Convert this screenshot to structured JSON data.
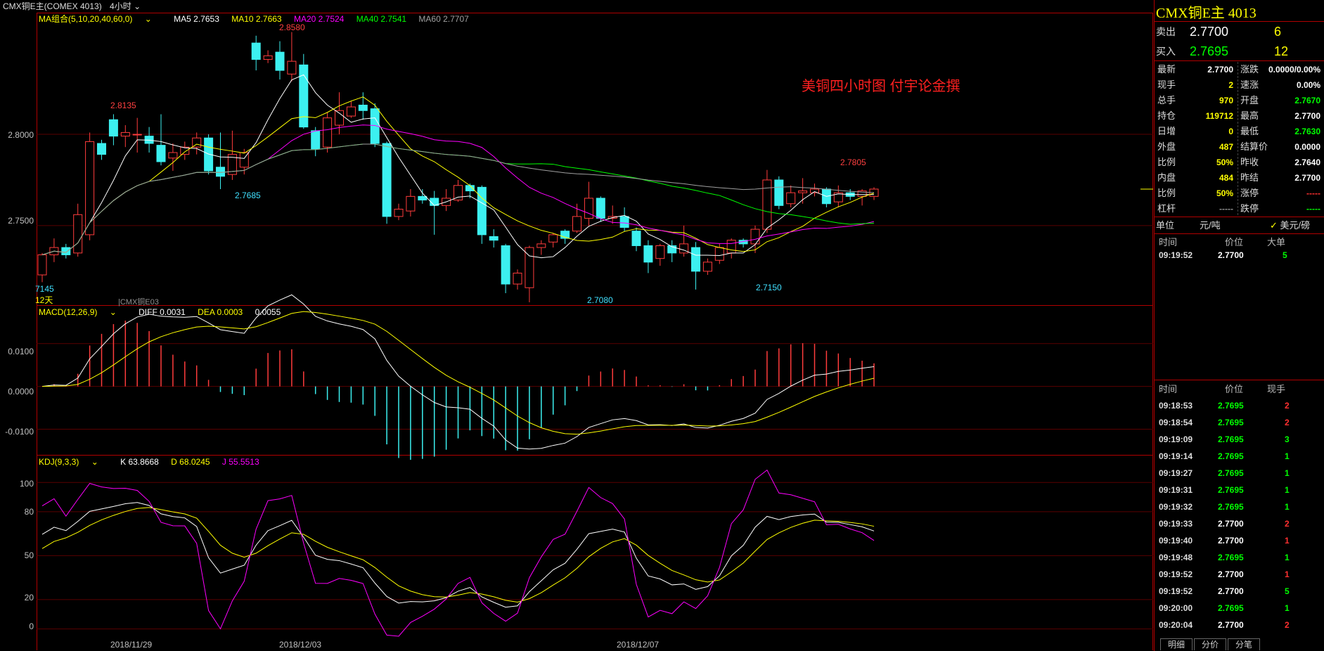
{
  "titlebar": {
    "symbol": "CMX铜E主(COMEX 4013)",
    "period": "4小时"
  },
  "annotation_text": "美铜四小时图  付宇论金撰",
  "ma_legend": {
    "group": "MA组合(5,10,20,40,60,0)",
    "ma5": "MA5 2.7653",
    "ma10": "MA10 2.7663",
    "ma20": "MA20 2.7524",
    "ma40": "MA40 2.7541",
    "ma60": "MA60 2.7707",
    "colors": {
      "ma5": "#ffffff",
      "ma10": "#ffff00",
      "ma20": "#ff00ff",
      "ma40": "#00ff00",
      "ma60": "#a0a0a0"
    }
  },
  "macd_legend": {
    "title": "MACD(12,26,9)",
    "diff": "DIFF 0.0031",
    "dea": "DEA 0.0003",
    "macd": "0.0055"
  },
  "kdj_legend": {
    "title": "KDJ(9,3,3)",
    "k": "K 63.8668",
    "d": "D 68.0245",
    "j": "J 55.5513"
  },
  "price_axis": [
    "2.8000",
    "2.7500"
  ],
  "macd_axis": [
    "0.0100",
    "0.0000",
    "-0.0100"
  ],
  "kdj_axis": [
    "100",
    "80",
    "50",
    "20",
    "0"
  ],
  "date_axis": [
    "2018/11/29",
    "2018/12/03",
    "2018/12/07"
  ],
  "price_annotations": [
    {
      "text": "2.8580",
      "color": "#ff4040"
    },
    {
      "text": "2.8135",
      "color": "#ff4040"
    },
    {
      "text": "2.7685",
      "color": "#40e0ff"
    },
    {
      "text": "2.7805",
      "color": "#ff4040"
    },
    {
      "text": "2.7080",
      "color": "#40e0ff"
    },
    {
      "text": "2.7150",
      "color": "#40e0ff"
    },
    {
      "text": "7145",
      "color": "#40e0ff"
    },
    {
      "text": "12天",
      "color": "#ffff00"
    },
    {
      "text": "|CMX铜E03",
      "color": "#909090"
    }
  ],
  "chart_data": {
    "type": "candlestick",
    "candles": [
      [
        2.723,
        2.734,
        2.719,
        2.735
      ],
      [
        2.734,
        2.738,
        2.73,
        2.743
      ],
      [
        2.738,
        2.734,
        2.732,
        2.74
      ],
      [
        2.735,
        2.756,
        2.733,
        2.762
      ],
      [
        2.745,
        2.796,
        2.742,
        2.801
      ],
      [
        2.795,
        2.789,
        2.786,
        2.797
      ],
      [
        2.808,
        2.799,
        2.794,
        2.811
      ],
      [
        2.799,
        2.801,
        2.793,
        2.805
      ],
      [
        2.8,
        2.8,
        2.79,
        2.809
      ],
      [
        2.799,
        2.795,
        2.79,
        2.804
      ],
      [
        2.794,
        2.785,
        2.783,
        2.811
      ],
      [
        2.787,
        2.79,
        2.78,
        2.795
      ],
      [
        2.789,
        2.793,
        2.786,
        2.796
      ],
      [
        2.793,
        2.798,
        2.789,
        2.801
      ],
      [
        2.798,
        2.78,
        2.778,
        2.8
      ],
      [
        2.782,
        2.777,
        2.77,
        2.801
      ],
      [
        2.778,
        2.789,
        2.775,
        2.802
      ],
      [
        2.782,
        2.79,
        2.778,
        2.792
      ],
      [
        2.85,
        2.841,
        2.835,
        2.854
      ],
      [
        2.841,
        2.843,
        2.839,
        2.846
      ],
      [
        2.845,
        2.835,
        2.83,
        2.851
      ],
      [
        2.833,
        2.84,
        2.829,
        2.856
      ],
      [
        2.838,
        2.804,
        2.803,
        2.844
      ],
      [
        2.802,
        2.792,
        2.788,
        2.804
      ],
      [
        2.793,
        2.809,
        2.79,
        2.812
      ],
      [
        2.805,
        2.813,
        2.8,
        2.823
      ],
      [
        2.81,
        2.815,
        2.809,
        2.818
      ],
      [
        2.816,
        2.813,
        2.808,
        2.823
      ],
      [
        2.814,
        2.795,
        2.793,
        2.817
      ],
      [
        2.795,
        2.755,
        2.751,
        2.796
      ],
      [
        2.755,
        2.759,
        2.753,
        2.762
      ],
      [
        2.758,
        2.766,
        2.755,
        2.77
      ],
      [
        2.766,
        2.764,
        2.762,
        2.77
      ],
      [
        2.765,
        2.761,
        2.745,
        2.769
      ],
      [
        2.761,
        2.765,
        2.758,
        2.77
      ],
      [
        2.764,
        2.772,
        2.763,
        2.775
      ],
      [
        2.772,
        2.769,
        2.765,
        2.773
      ],
      [
        2.771,
        2.745,
        2.74,
        2.772
      ],
      [
        2.744,
        2.742,
        2.738,
        2.748
      ],
      [
        2.739,
        2.718,
        2.713,
        2.74
      ],
      [
        2.718,
        2.724,
        2.715,
        2.726
      ],
      [
        2.716,
        2.738,
        2.708,
        2.739
      ],
      [
        2.738,
        2.74,
        2.734,
        2.742
      ],
      [
        2.741,
        2.745,
        2.738,
        2.746
      ],
      [
        2.747,
        2.743,
        2.74,
        2.748
      ],
      [
        2.747,
        2.755,
        2.746,
        2.762
      ],
      [
        2.754,
        2.765,
        2.75,
        2.774
      ],
      [
        2.765,
        2.754,
        2.752,
        2.766
      ],
      [
        2.754,
        2.755,
        2.751,
        2.761
      ],
      [
        2.755,
        2.749,
        2.747,
        2.76
      ],
      [
        2.747,
        2.739,
        2.736,
        2.749
      ],
      [
        2.739,
        2.73,
        2.724,
        2.742
      ],
      [
        2.732,
        2.739,
        2.728,
        2.74
      ],
      [
        2.739,
        2.735,
        2.73,
        2.742
      ],
      [
        2.735,
        2.74,
        2.733,
        2.75
      ],
      [
        2.738,
        2.725,
        2.715,
        2.741
      ],
      [
        2.725,
        2.73,
        2.723,
        2.732
      ],
      [
        2.731,
        2.738,
        2.729,
        2.74
      ],
      [
        2.735,
        2.742,
        2.732,
        2.743
      ],
      [
        2.742,
        2.74,
        2.738,
        2.743
      ],
      [
        2.74,
        2.748,
        2.735,
        2.75
      ],
      [
        2.748,
        2.775,
        2.746,
        2.7805
      ],
      [
        2.775,
        2.761,
        2.759,
        2.777
      ],
      [
        2.762,
        2.768,
        2.76,
        2.772
      ],
      [
        2.768,
        2.769,
        2.762,
        2.776
      ],
      [
        2.768,
        2.77,
        2.766,
        2.773
      ],
      [
        2.77,
        2.762,
        2.76,
        2.771
      ],
      [
        2.763,
        2.768,
        2.76,
        2.772
      ],
      [
        2.768,
        2.766,
        2.764,
        2.77
      ],
      [
        2.766,
        2.769,
        2.761,
        2.77
      ],
      [
        2.766,
        2.77,
        2.764,
        2.771
      ]
    ],
    "price_range": [
      2.708,
      2.862
    ],
    "macd_range": [
      -0.0155,
      0.018
    ],
    "kdj_range": [
      -5,
      115
    ]
  },
  "quote": {
    "title": "CMX铜E主  4013",
    "sell_label": "卖出",
    "sell_price": "2.7700",
    "sell_vol": "6",
    "buy_label": "买入",
    "buy_price": "2.7695",
    "buy_vol": "12",
    "left": [
      {
        "label": "最新",
        "value": "2.7700",
        "color": "#ffffff"
      },
      {
        "label": "现手",
        "value": "2",
        "color": "#ffff00"
      },
      {
        "label": "总手",
        "value": "970",
        "color": "#ffff00"
      },
      {
        "label": "持仓",
        "value": "119712",
        "color": "#ffff00"
      },
      {
        "label": "日增",
        "value": "0",
        "color": "#ffff00"
      },
      {
        "label": "外盘",
        "value": "487",
        "color": "#ffff00"
      },
      {
        "label": "比例",
        "value": "50%",
        "color": "#ffff00"
      },
      {
        "label": "内盘",
        "value": "484",
        "color": "#ffff00"
      },
      {
        "label": "比例",
        "value": "50%",
        "color": "#ffff00"
      },
      {
        "label": "杠杆",
        "value": "-----",
        "color": "#909090"
      }
    ],
    "right": [
      {
        "label": "涨跌",
        "value": "0.0000/0.00%",
        "color": "#ffffff"
      },
      {
        "label": "速涨",
        "value": "0.00%",
        "color": "#ffffff"
      },
      {
        "label": "开盘",
        "value": "2.7670",
        "color": "#00ff00"
      },
      {
        "label": "最高",
        "value": "2.7700",
        "color": "#ffffff"
      },
      {
        "label": "最低",
        "value": "2.7630",
        "color": "#00ff00"
      },
      {
        "label": "结算价",
        "value": "0.0000",
        "color": "#ffffff"
      },
      {
        "label": "昨收",
        "value": "2.7640",
        "color": "#ffffff"
      },
      {
        "label": "昨结",
        "value": "2.7700",
        "color": "#ffffff"
      },
      {
        "label": "涨停",
        "value": "-----",
        "color": "#ff3030"
      },
      {
        "label": "跌停",
        "value": "-----",
        "color": "#00ff00"
      }
    ],
    "unit_label": "单位",
    "unit_value": "元/吨",
    "unit_alt": "美元/磅",
    "bigorder_headers": [
      "时间",
      "价位",
      "大单"
    ],
    "bigorder_row": {
      "time": "09:19:52",
      "price": "2.7700",
      "vol": "5"
    },
    "tick_headers": [
      "时间",
      "价位",
      "现手"
    ],
    "ticks": [
      {
        "time": "09:18:53",
        "price": "2.7695",
        "vol": "2",
        "pc": "#00ff00",
        "vc": "#ff3030"
      },
      {
        "time": "09:18:54",
        "price": "2.7695",
        "vol": "2",
        "pc": "#00ff00",
        "vc": "#ff3030"
      },
      {
        "time": "09:19:09",
        "price": "2.7695",
        "vol": "3",
        "pc": "#00ff00",
        "vc": "#00ff00"
      },
      {
        "time": "09:19:14",
        "price": "2.7695",
        "vol": "1",
        "pc": "#00ff00",
        "vc": "#00ff00"
      },
      {
        "time": "09:19:27",
        "price": "2.7695",
        "vol": "1",
        "pc": "#00ff00",
        "vc": "#00ff00"
      },
      {
        "time": "09:19:31",
        "price": "2.7695",
        "vol": "1",
        "pc": "#00ff00",
        "vc": "#00ff00"
      },
      {
        "time": "09:19:32",
        "price": "2.7695",
        "vol": "1",
        "pc": "#00ff00",
        "vc": "#00ff00"
      },
      {
        "time": "09:19:33",
        "price": "2.7700",
        "vol": "2",
        "pc": "#ffffff",
        "vc": "#ff3030"
      },
      {
        "time": "09:19:40",
        "price": "2.7700",
        "vol": "1",
        "pc": "#ffffff",
        "vc": "#ff3030"
      },
      {
        "time": "09:19:48",
        "price": "2.7695",
        "vol": "1",
        "pc": "#00ff00",
        "vc": "#00ff00"
      },
      {
        "time": "09:19:52",
        "price": "2.7700",
        "vol": "1",
        "pc": "#ffffff",
        "vc": "#ff3030"
      },
      {
        "time": "09:19:52",
        "price": "2.7700",
        "vol": "5",
        "pc": "#ffffff",
        "vc": "#00ff00"
      },
      {
        "time": "09:20:00",
        "price": "2.7695",
        "vol": "1",
        "pc": "#00ff00",
        "vc": "#00ff00"
      },
      {
        "time": "09:20:04",
        "price": "2.7700",
        "vol": "2",
        "pc": "#ffffff",
        "vc": "#ff3030"
      }
    ],
    "tabs": [
      "明细",
      "分价",
      "分笔"
    ]
  }
}
